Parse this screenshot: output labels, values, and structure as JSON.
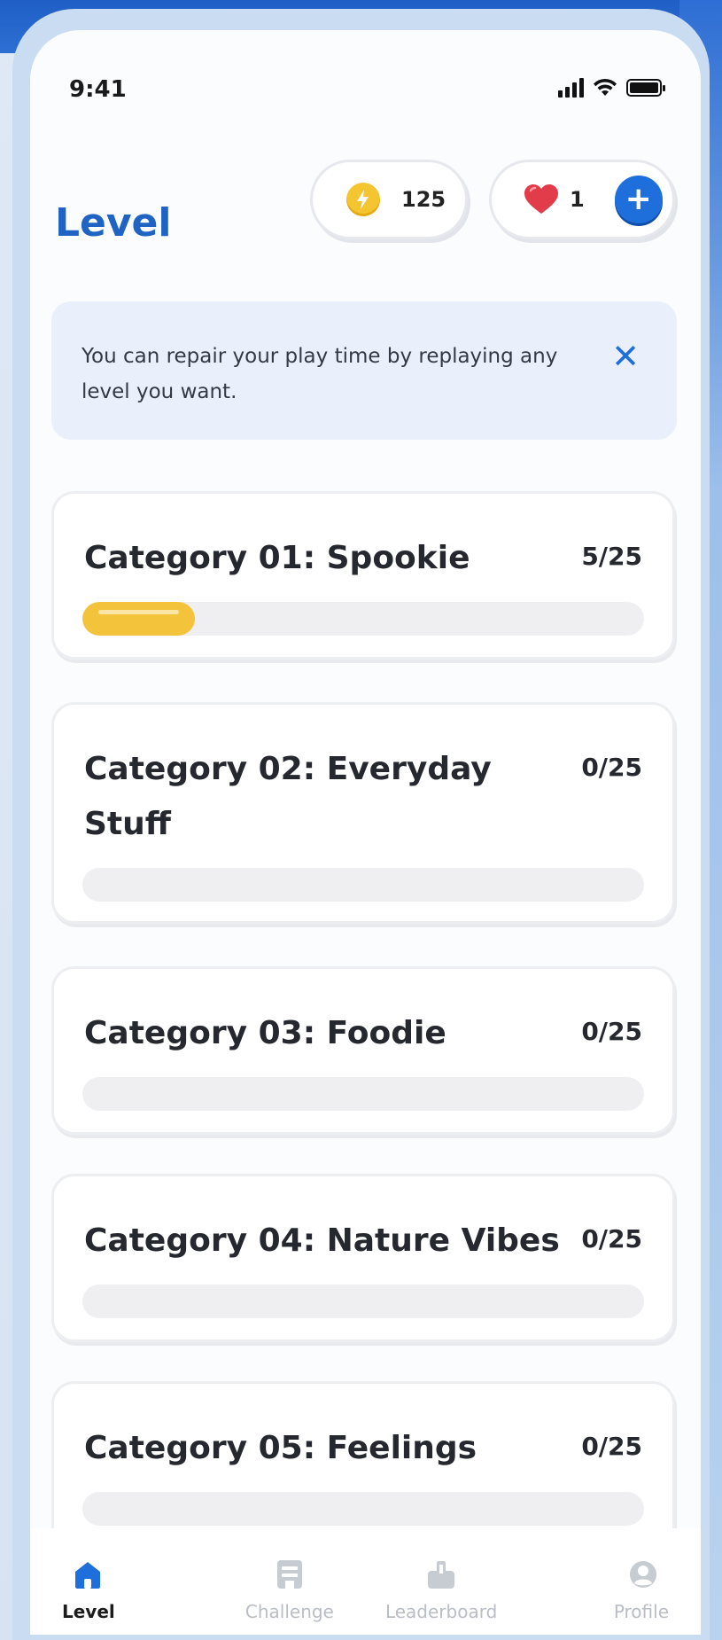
{
  "status": {
    "time": "9:41"
  },
  "header": {
    "title": "Level",
    "energy": {
      "icon": "lightning-coin-icon",
      "value": "125",
      "color": "#f4c531"
    },
    "lives": {
      "icon": "heart-icon",
      "value": "1",
      "add_icon": "plus-icon",
      "color": "#e23b4a"
    }
  },
  "tip": {
    "text": "You can repair your play time by replaying any level you want.",
    "close_icon": "close-icon"
  },
  "categories": [
    {
      "title": "Category 01: Spookie",
      "count": "5/25",
      "progress": 0.2
    },
    {
      "title": "Category 02: Everyday Stuff",
      "count": "0/25",
      "progress": 0
    },
    {
      "title": "Category 03: Foodie",
      "count": "0/25",
      "progress": 0
    },
    {
      "title": "Category 04: Nature Vibes",
      "count": "0/25",
      "progress": 0
    },
    {
      "title": "Category 05: Feelings",
      "count": "0/25",
      "progress": 0
    }
  ],
  "tabs": [
    {
      "label": "Level",
      "icon": "home-icon",
      "active": true
    },
    {
      "label": "Challenge",
      "icon": "challenge-icon",
      "active": false
    },
    {
      "label": "Leaderboard",
      "icon": "leaderboard-icon",
      "active": false
    },
    {
      "label": "Profile",
      "icon": "profile-icon",
      "active": false
    }
  ],
  "colors": {
    "accent": "#1f63c4",
    "progress": "#f3c43b",
    "track": "#efeff2"
  }
}
